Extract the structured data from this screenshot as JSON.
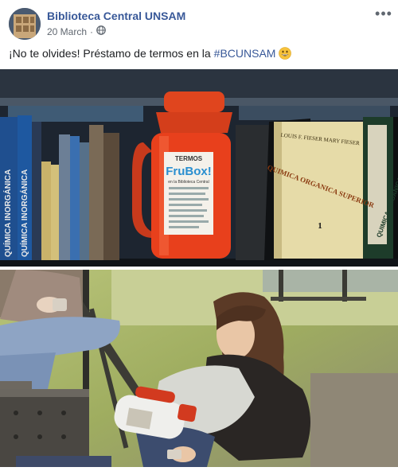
{
  "post": {
    "page_name": "Biblioteca Central UNSAM",
    "date": "20 March",
    "separator": "·",
    "audience_icon": "globe-icon",
    "more_icon": "more-options-icon",
    "more_label": "•••",
    "text_before": "¡No te olvides! Préstamo de termos en la",
    "hashtag": "#BCUNSAM",
    "emoji_icon": "grinning-face-emoji"
  },
  "photos": {
    "photo_1": {
      "thermos_label": {
        "line1": "TERMOS",
        "brand": "FruBox!",
        "line3": "en la Biblioteca Central"
      },
      "book_spines": {
        "left_1": "QUÍMICA INORGÁNICA",
        "left_2": "QUÍMICA INORGÁNICA",
        "right_authors": "LOUIS F. FIESER  MARY FIESER",
        "right_title": "QUIMICA ORGANICA SUPERIOR",
        "right_volume": "1",
        "right_thin": "QUIMICA ORGANICA"
      }
    },
    "photo_2": {}
  },
  "colors": {
    "link": "#385898",
    "meta": "#606770",
    "thermos": "#e8401c"
  }
}
